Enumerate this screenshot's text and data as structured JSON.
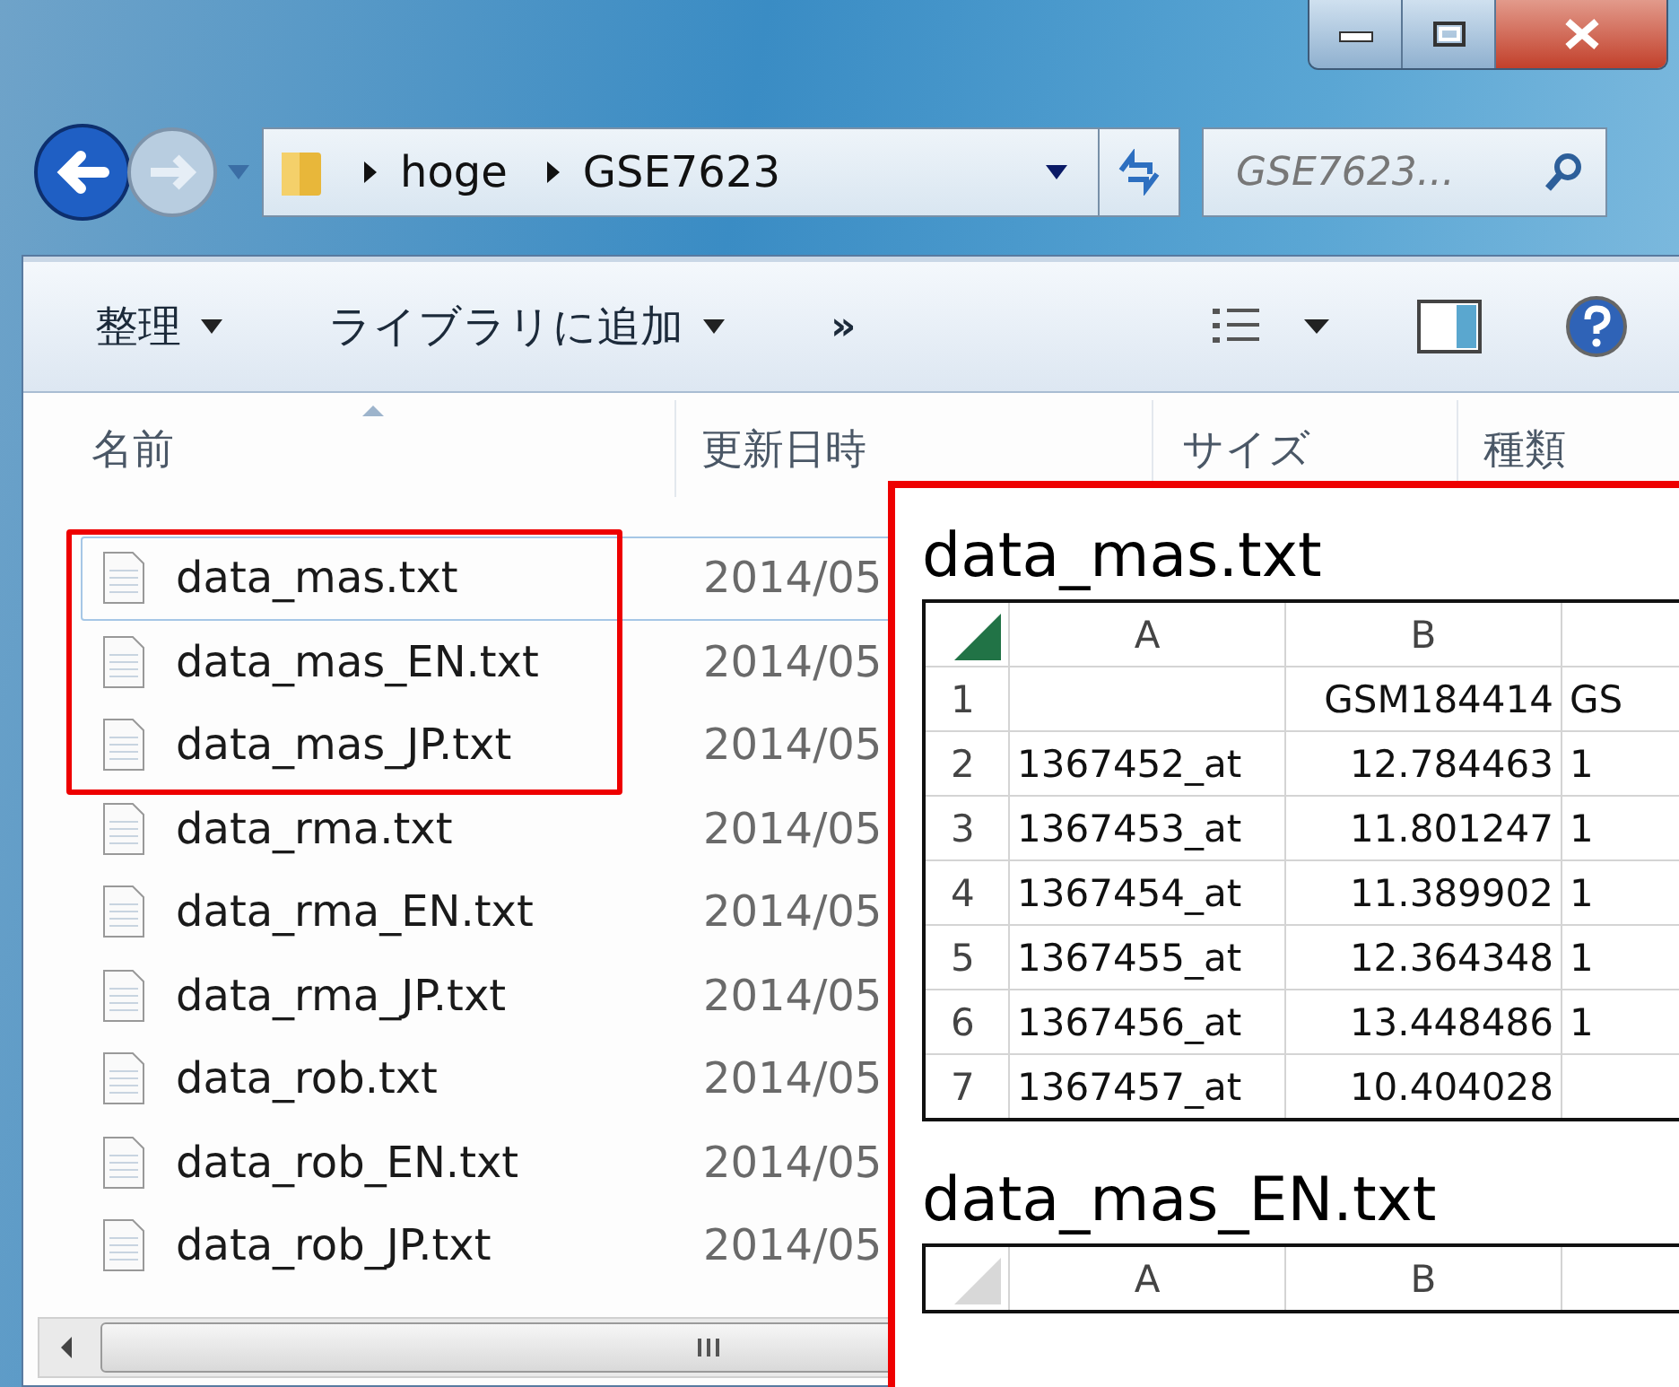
{
  "address": {
    "crumbs": [
      "hoge",
      "GSE7623"
    ]
  },
  "search": {
    "placeholder": "GSE7623..."
  },
  "toolbar": [
    {
      "label": "整理",
      "kind": "menu"
    },
    {
      "label": "ライブラリに追加",
      "kind": "menu"
    },
    {
      "label": "»",
      "kind": "more"
    }
  ],
  "columns": [
    {
      "label": "名前"
    },
    {
      "label": "更新日時"
    },
    {
      "label": "サイズ"
    },
    {
      "label": "種類"
    }
  ],
  "files": [
    {
      "name": "data_mas.txt",
      "date": "2014/05",
      "focused": true,
      "marked": true
    },
    {
      "name": "data_mas_EN.txt",
      "date": "2014/05",
      "focused": false,
      "marked": true
    },
    {
      "name": "data_mas_JP.txt",
      "date": "2014/05",
      "focused": false,
      "marked": true
    },
    {
      "name": "data_rma.txt",
      "date": "2014/05",
      "focused": false,
      "marked": false
    },
    {
      "name": "data_rma_EN.txt",
      "date": "2014/05",
      "focused": false,
      "marked": false
    },
    {
      "name": "data_rma_JP.txt",
      "date": "2014/05",
      "focused": false,
      "marked": false
    },
    {
      "name": "data_rob.txt",
      "date": "2014/05",
      "focused": false,
      "marked": false
    },
    {
      "name": "data_rob_EN.txt",
      "date": "2014/05",
      "focused": false,
      "marked": false
    },
    {
      "name": "data_rob_JP.txt",
      "date": "2014/05",
      "focused": false,
      "marked": false
    }
  ],
  "sheets": [
    {
      "title": "data_mas.txt",
      "active": true,
      "columns": [
        "A",
        "B"
      ],
      "rows": [
        {
          "num": "1",
          "cells": [
            "",
            "GSM184414",
            "GS"
          ]
        },
        {
          "num": "2",
          "cells": [
            "1367452_at",
            "12.784463",
            "1"
          ]
        },
        {
          "num": "3",
          "cells": [
            "1367453_at",
            "11.801247",
            "1"
          ]
        },
        {
          "num": "4",
          "cells": [
            "1367454_at",
            "11.389902",
            "1"
          ]
        },
        {
          "num": "5",
          "cells": [
            "1367455_at",
            "12.364348",
            "1"
          ]
        },
        {
          "num": "6",
          "cells": [
            "1367456_at",
            "13.448486",
            "1"
          ]
        },
        {
          "num": "7",
          "cells": [
            "1367457_at",
            "10.404028",
            ""
          ]
        }
      ]
    },
    {
      "title": "data_mas_EN.txt",
      "active": false,
      "columns": [
        "A",
        "B"
      ]
    }
  ]
}
